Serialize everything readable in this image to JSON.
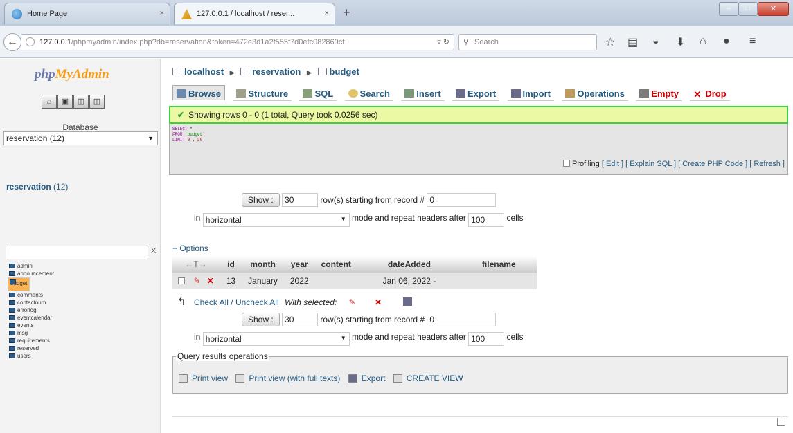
{
  "browser": {
    "tabs": [
      {
        "label": "Home Page"
      },
      {
        "label": "127.0.0.1 / localhost / reser..."
      }
    ],
    "close_glyph": "×",
    "new_tab_glyph": "+",
    "url_host": "127.0.0.1",
    "url_rest": "/phpmyadmin/index.php?db=reservation&token=472e3d1a2f555f7d0efc082869cf",
    "search_placeholder": "Search"
  },
  "sidebar": {
    "logo_php": "php",
    "logo_my": "My",
    "logo_admin": "Admin",
    "database_label": "Database",
    "database_select": "reservation (12)",
    "db_link_name": "reservation",
    "db_link_count": "(12)",
    "filter_clear": "X",
    "tables": [
      {
        "name": "admin",
        "selected": false
      },
      {
        "name": "announcement",
        "selected": false
      },
      {
        "name": "budget",
        "selected": true
      },
      {
        "name": "comments",
        "selected": false
      },
      {
        "name": "contactnum",
        "selected": false
      },
      {
        "name": "errorlog",
        "selected": false
      },
      {
        "name": "eventcalendar",
        "selected": false
      },
      {
        "name": "events",
        "selected": false
      },
      {
        "name": "msg",
        "selected": false
      },
      {
        "name": "requirements",
        "selected": false
      },
      {
        "name": "reserved",
        "selected": false
      },
      {
        "name": "users",
        "selected": false
      }
    ]
  },
  "breadcrumb": {
    "server": "localhost",
    "database": "reservation",
    "table": "budget"
  },
  "tabs": {
    "browse": "Browse",
    "structure": "Structure",
    "sql": "SQL",
    "search": "Search",
    "insert": "Insert",
    "export": "Export",
    "import": "Import",
    "operations": "Operations",
    "empty": "Empty",
    "drop": "Drop"
  },
  "message": "Showing rows 0 - 0 (1 total, Query took 0.0256 sec)",
  "sql": {
    "line1_kw": "SELECT",
    "line1_rest": " *",
    "line2_kw": "FROM",
    "line2_rest": " `budget`",
    "line3_kw": "LIMIT",
    "line3_rest": " 0 , 30"
  },
  "sql_actions": {
    "profiling": "Profiling",
    "edit": "[ Edit ]",
    "explain": "[ Explain SQL ]",
    "php": "[ Create PHP Code ]",
    "refresh": "[ Refresh ]"
  },
  "nav": {
    "show_button": "Show :",
    "rows": "30",
    "rows_text": "row(s) starting from record #",
    "start": "0",
    "in_text": "in",
    "mode": "horizontal",
    "mode_text": "mode and repeat headers after",
    "repeat": "100",
    "cells_text": "cells"
  },
  "options_link": "+ Options",
  "table": {
    "columns": [
      "id",
      "month",
      "year",
      "content",
      "dateAdded",
      "filename"
    ],
    "rows": [
      {
        "id": "13",
        "month": "January",
        "year": "2022",
        "content": "",
        "dateAdded": "Jan 06, 2022 -",
        "filename": ""
      }
    ]
  },
  "check_all": {
    "link": "Check All / Uncheck All",
    "with_selected": "With selected:"
  },
  "query_ops": {
    "legend": "Query results operations",
    "print_view": "Print view",
    "print_view_full": "Print view (with full texts)",
    "export": "Export",
    "create_view": "CREATE VIEW"
  },
  "colors": {
    "link": "#235a81",
    "success_border": "#3bd13b",
    "selected_row": "#f9b254"
  }
}
